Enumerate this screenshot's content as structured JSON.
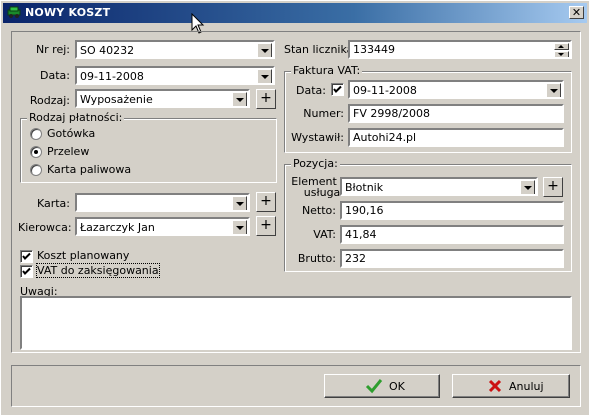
{
  "window": {
    "title": "NOWY KOSZT",
    "close_glyph": "✕"
  },
  "left": {
    "nr_rej_label": "Nr rej:",
    "nr_rej_value": "SO 40232",
    "data_label": "Data:",
    "data_value": "09-11-2008",
    "rodzaj_label": "Rodzaj:",
    "rodzaj_value": "Wyposażenie",
    "platnosc_title": "Rodzaj płatności:",
    "platnosc_options": [
      "Gotówka",
      "Przelew",
      "Karta paliwowa"
    ],
    "platnosc_selected": "Przelew",
    "karta_label": "Karta:",
    "karta_value": "",
    "kierowca_label": "Kierowca:",
    "kierowca_value": "Łazarczyk Jan",
    "koszt_planowany": "Koszt planowany",
    "vat_do_zaks": "VAT do zaksięgowania"
  },
  "right": {
    "stan_label": "Stan licznika:",
    "stan_value": "133449",
    "faktura_title": "Faktura VAT:",
    "f_data_label": "Data:",
    "f_data_value": "09-11-2008",
    "numer_label": "Numer:",
    "numer_value": "FV 2998/2008",
    "wystawil_label": "Wystawił:",
    "wystawil_value": "Autohi24.pl",
    "pozycja_title": "Pozycja:",
    "element_label_1": "Element /",
    "element_label_2": "usługa:",
    "element_value": "Błotnik",
    "netto_label": "Netto:",
    "netto_value": "190,16",
    "vat_label": "VAT:",
    "vat_value": "41,84",
    "brutto_label": "Brutto:",
    "brutto_value": "232"
  },
  "uwagi_label": "Uwagi:",
  "uwagi_value": "",
  "buttons": {
    "ok": "OK",
    "anuluj": "Anuluj",
    "plus": "+"
  },
  "colors": {
    "title_start": "#0a246a",
    "title_end": "#a6caf0",
    "face": "#d4d0c8",
    "ok_check": "#2e9e2e",
    "cancel_x": "#cc1111"
  }
}
